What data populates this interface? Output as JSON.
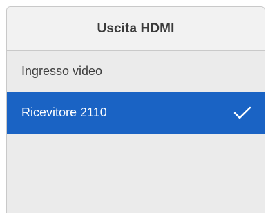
{
  "header": {
    "title": "Uscita HDMI"
  },
  "options": [
    {
      "label": "Ingresso video",
      "selected": false
    },
    {
      "label": "Ricevitore 2110",
      "selected": true
    }
  ],
  "icons": {
    "selected_indicator": "check-icon"
  },
  "colors": {
    "selected_background": "#1a63c4",
    "panel_background": "#ebebeb",
    "header_background": "#f2f2f2",
    "text": "#3f3f3f"
  }
}
